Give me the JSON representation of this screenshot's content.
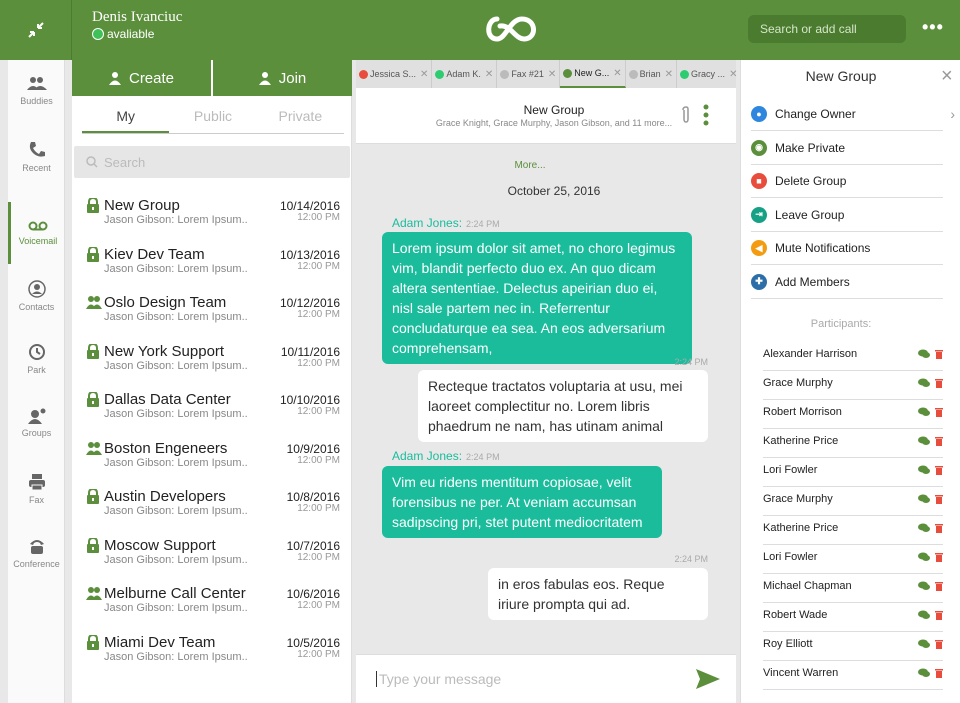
{
  "topbar": {
    "user_name": "Denis Ivanciuc",
    "user_status": "avaliable",
    "search_placeholder": "Search or add call",
    "more": "•••"
  },
  "nav": [
    {
      "label": "Buddies",
      "icon": "buddies-icon"
    },
    {
      "label": "Recent",
      "icon": "phone-icon"
    },
    {
      "label": "Voicemail",
      "icon": "voicemail-icon",
      "active": true
    },
    {
      "label": "Contacts",
      "icon": "contact-icon"
    },
    {
      "label": "Park",
      "icon": "park-icon"
    },
    {
      "label": "Groups",
      "icon": "groups-icon"
    },
    {
      "label": "Fax",
      "icon": "fax-icon"
    },
    {
      "label": "Conference",
      "icon": "conference-icon"
    }
  ],
  "list": {
    "create_label": "Create",
    "join_label": "Join",
    "tabs": [
      "My",
      "Public",
      "Private"
    ],
    "search_placeholder": "Search",
    "items": [
      {
        "title": "New Group",
        "sub": "Jason Gibson: Lorem Ipsum..",
        "date": "10/14/2016",
        "time": "12:00 PM",
        "icon": "lock"
      },
      {
        "title": "Kiev Dev Team",
        "sub": "Jason Gibson: Lorem Ipsum..",
        "date": "10/13/2016",
        "time": "12:00 PM",
        "icon": "lock"
      },
      {
        "title": "Oslo Design Team",
        "sub": "Jason Gibson: Lorem Ipsum..",
        "date": "10/12/2016",
        "time": "12:00 PM",
        "icon": "people"
      },
      {
        "title": "New York Support",
        "sub": "Jason Gibson: Lorem Ipsum..",
        "date": "10/11/2016",
        "time": "12:00 PM",
        "icon": "lock"
      },
      {
        "title": "Dallas Data Center",
        "sub": "Jason Gibson: Lorem Ipsum..",
        "date": "10/10/2016",
        "time": "12:00 PM",
        "icon": "lock"
      },
      {
        "title": "Boston Engeneers",
        "sub": "Jason Gibson: Lorem Ipsum..",
        "date": "10/9/2016",
        "time": "12:00 PM",
        "icon": "people"
      },
      {
        "title": "Austin Developers",
        "sub": "Jason Gibson: Lorem Ipsum..",
        "date": "10/8/2016",
        "time": "12:00 PM",
        "icon": "lock"
      },
      {
        "title": "Moscow Support",
        "sub": "Jason Gibson: Lorem Ipsum..",
        "date": "10/7/2016",
        "time": "12:00 PM",
        "icon": "lock"
      },
      {
        "title": "Melburne Call Center",
        "sub": "Jason Gibson: Lorem Ipsum..",
        "date": "10/6/2016",
        "time": "12:00 PM",
        "icon": "people"
      },
      {
        "title": "Miami Dev Team",
        "sub": "Jason Gibson: Lorem Ipsum..",
        "date": "10/5/2016",
        "time": "12:00 PM",
        "icon": "lock"
      }
    ]
  },
  "chat": {
    "tabs": [
      {
        "label": "Jessica S...",
        "color": "#e74c3c"
      },
      {
        "label": "Adam K.",
        "color": "#2ecc71"
      },
      {
        "label": "Fax #21",
        "color": "#bbbbbb"
      },
      {
        "label": "New G...",
        "color": "#5b8f3c",
        "active": true
      },
      {
        "label": "Brian",
        "color": "#bbbbbb"
      },
      {
        "label": "Gracy ...",
        "color": "#2ecc71"
      }
    ],
    "header_title": "New Group",
    "header_sub": "Grace Knight, Grace Murphy, Jason Gibson, and 11 more...",
    "more_link": "More...",
    "date": "October 25, 2016",
    "messages": [
      {
        "sender": "Adam Jones:",
        "time": "2:24 PM",
        "text": "Lorem ipsum dolor sit amet, no choro legimus vim, blandit perfecto duo ex. An quo dicam altera sententiae. Delectus apeirian duo ei, nisl sale partem nec in. Referrentur concludaturque ea sea. An eos adversarium comprehensam,"
      },
      {
        "time": "2:24 PM",
        "text": "Recteque tractatos voluptaria at usu, mei laoreet complectitur no. Lorem libris phaedrum ne nam, has utinam animal"
      },
      {
        "sender": "Adam Jones:",
        "time": "2:24 PM",
        "text": "Vim eu ridens mentitum copiosae, velit forensibus ne per. At veniam accumsan sadipscing pri, stet putent mediocritatem"
      },
      {
        "time": "2:24 PM",
        "text": "in eros fabulas eos. Reque iriure prompta qui ad."
      }
    ],
    "compose_placeholder": "Type your message"
  },
  "group": {
    "title": "New Group",
    "close": "×",
    "actions": [
      {
        "label": "Change Owner",
        "color": "#2e86de",
        "icon": "owner-icon"
      },
      {
        "label": "Make Private",
        "color": "#5b8f3c",
        "icon": "private-icon"
      },
      {
        "label": "Delete Group",
        "color": "#e74c3c",
        "icon": "delete-icon"
      },
      {
        "label": "Leave Group",
        "color": "#16a085",
        "icon": "leave-icon"
      },
      {
        "label": "Mute Notifications",
        "color": "#f39c12",
        "icon": "mute-icon"
      },
      {
        "label": "Add Members",
        "color": "#2c6fa8",
        "icon": "add-members-icon"
      }
    ],
    "participants_label": "Participants:",
    "participants": [
      "Alexander Harrison",
      "Grace Murphy",
      "Robert Morrison",
      "Katherine Price",
      "Lori Fowler",
      "Grace Murphy",
      "Katherine Price",
      "Lori Fowler",
      "Michael Chapman",
      "Robert Wade",
      "Roy Elliott",
      "Vincent Warren"
    ]
  },
  "colors": {
    "brand": "#5b8f3c",
    "message_in": "#1abc9c",
    "delete": "#e74c3c"
  }
}
